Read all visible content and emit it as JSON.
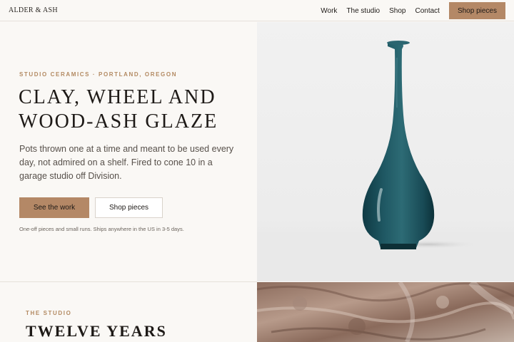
{
  "header": {
    "logo": "ALDER & ASH",
    "nav": [
      "Work",
      "The studio",
      "Shop",
      "Contact"
    ],
    "cta": "Shop pieces"
  },
  "hero": {
    "eyebrow": "STUDIO CERAMICS · PORTLAND, OREGON",
    "headline": "CLAY, WHEEL AND WOOD-ASH GLAZE",
    "lede": "Pots thrown one at a time and meant to be used every day, not admired on a shelf. Fired to cone 10 in a garage studio off Division.",
    "primary_button": "See the work",
    "secondary_button": "Shop pieces",
    "fineprint": "One-off pieces and small runs. Ships anywhere in the US in 3-5 days."
  },
  "studio": {
    "eyebrow": "THE STUDIO",
    "title": "TWELVE YEARS"
  },
  "colors": {
    "accent": "#b48866",
    "eyebrow": "#b38a62",
    "background": "#faf8f5",
    "vase_glaze": "#1f5863"
  }
}
